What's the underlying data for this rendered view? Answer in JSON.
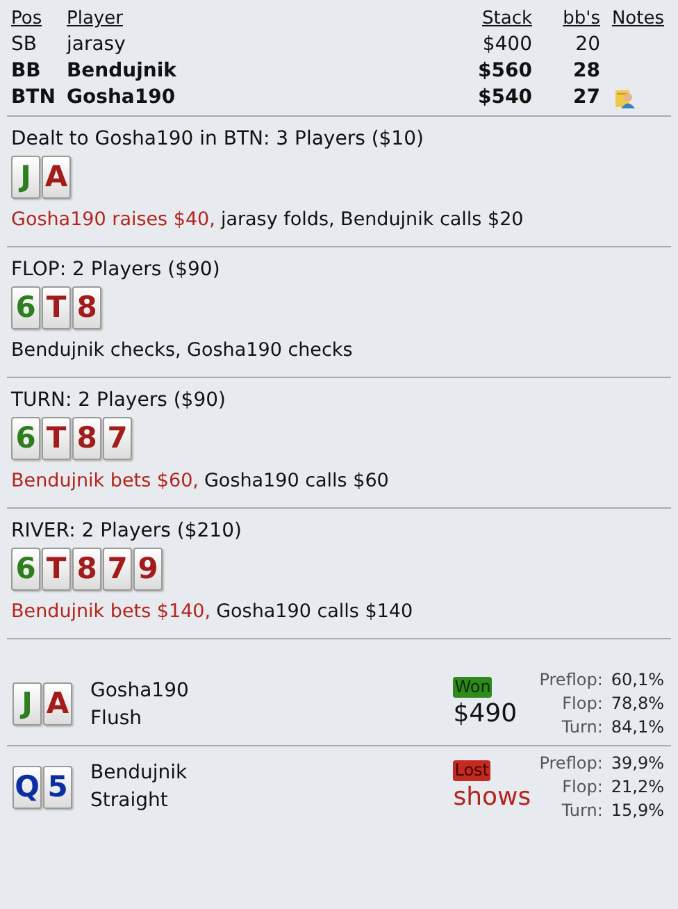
{
  "players": {
    "columns": [
      "Pos",
      "Player",
      "Stack",
      "bb's",
      "Notes"
    ],
    "rows": [
      {
        "pos": "SB",
        "player": "jarasy",
        "stack": "$400",
        "bbs": "20",
        "bold": false,
        "has_note": false
      },
      {
        "pos": "BB",
        "player": "Bendujnik",
        "stack": "$560",
        "bbs": "28",
        "bold": true,
        "has_note": false
      },
      {
        "pos": "BTN",
        "player": "Gosha190",
        "stack": "$540",
        "bbs": "27",
        "bold": true,
        "has_note": true
      }
    ]
  },
  "streets": [
    {
      "title": "Dealt to Gosha190 in BTN: 3 Players ($10)",
      "cards": [
        {
          "rank": "J",
          "color": "#2e7d1f"
        },
        {
          "rank": "A",
          "color": "#a31c1c"
        }
      ],
      "actions": [
        {
          "text": "Gosha190 raises $40,",
          "highlight": true
        },
        {
          "text": "jarasy folds, Bendujnik calls $20",
          "highlight": false
        }
      ]
    },
    {
      "title": "FLOP: 2 Players ($90)",
      "cards": [
        {
          "rank": "6",
          "color": "#2e7d1f"
        },
        {
          "rank": "T",
          "color": "#a31c1c"
        },
        {
          "rank": "8",
          "color": "#a31c1c"
        }
      ],
      "actions": [
        {
          "text": "Bendujnik checks, Gosha190 checks",
          "highlight": false
        }
      ]
    },
    {
      "title": "TURN: 2 Players ($90)",
      "cards": [
        {
          "rank": "6",
          "color": "#2e7d1f"
        },
        {
          "rank": "T",
          "color": "#a31c1c"
        },
        {
          "rank": "8",
          "color": "#a31c1c"
        },
        {
          "rank": "7",
          "color": "#a31c1c"
        }
      ],
      "actions": [
        {
          "text": "Bendujnik bets $60,",
          "highlight": true
        },
        {
          "text": "Gosha190 calls $60",
          "highlight": false
        }
      ]
    },
    {
      "title": "RIVER: 2 Players ($210)",
      "cards": [
        {
          "rank": "6",
          "color": "#2e7d1f"
        },
        {
          "rank": "T",
          "color": "#a31c1c"
        },
        {
          "rank": "8",
          "color": "#a31c1c"
        },
        {
          "rank": "7",
          "color": "#a31c1c"
        },
        {
          "rank": "9",
          "color": "#a31c1c"
        }
      ],
      "actions": [
        {
          "text": "Bendujnik bets $140,",
          "highlight": true
        },
        {
          "text": "Gosha190 calls $140",
          "highlight": false
        }
      ]
    }
  ],
  "showdown": [
    {
      "cards": [
        {
          "rank": "J",
          "color": "#2e7d1f"
        },
        {
          "rank": "A",
          "color": "#a31c1c"
        }
      ],
      "player": "Gosha190",
      "hand": "Flush",
      "result": {
        "kind": "won",
        "label": "Won"
      },
      "outcome": "$490",
      "equity": [
        {
          "street": "Preflop:",
          "value": "60,1%"
        },
        {
          "street": "Flop:",
          "value": "78,8%"
        },
        {
          "street": "Turn:",
          "value": "84,1%"
        }
      ]
    },
    {
      "cards": [
        {
          "rank": "Q",
          "color": "#0b2fa3"
        },
        {
          "rank": "5",
          "color": "#0b2fa3"
        }
      ],
      "player": "Bendujnik",
      "hand": "Straight",
      "result": {
        "kind": "lost",
        "label": "Lost"
      },
      "outcome": "shows",
      "equity": [
        {
          "street": "Preflop:",
          "value": "39,9%"
        },
        {
          "street": "Flop:",
          "value": "21,2%"
        },
        {
          "street": "Turn:",
          "value": "15,9%"
        }
      ]
    }
  ]
}
